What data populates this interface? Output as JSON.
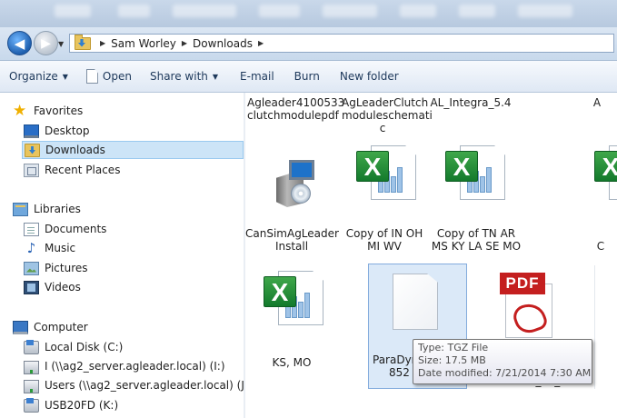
{
  "breadcrumb": {
    "items": [
      "Sam Worley",
      "Downloads"
    ]
  },
  "toolbar": {
    "organize": "Organize",
    "open": "Open",
    "share_with": "Share with",
    "email": "E-mail",
    "burn": "Burn",
    "new_folder": "New folder"
  },
  "nav": {
    "favorites": "Favorites",
    "desktop": "Desktop",
    "downloads": "Downloads",
    "recent_places": "Recent Places",
    "libraries": "Libraries",
    "documents": "Documents",
    "music": "Music",
    "pictures": "Pictures",
    "videos": "Videos",
    "computer": "Computer",
    "local_disk": "Local Disk (C:)",
    "drive_i": "I (\\\\ag2_server.agleader.local) (I:)",
    "drive_j": "Users (\\\\ag2_server.agleader.local) (J:",
    "drive_k": "USB20FD (K:)"
  },
  "files": {
    "row1": [
      {
        "line1": "Agleader4100533",
        "line2": "clutchmodulepdf",
        "line3": ""
      },
      {
        "line1": "AgLeaderClutch",
        "line2": "moduleschemati",
        "line3": "c"
      },
      {
        "line1": "AL_Integra_5.4",
        "line2": "",
        "line3": ""
      },
      {
        "line1": "A",
        "line2": "",
        "line3": ""
      }
    ],
    "row2": [
      {
        "line1": "CanSimAgLeader",
        "line2": "Install",
        "icon": "installer-icon"
      },
      {
        "line1": "Copy of IN OH",
        "line2": "MI WV",
        "icon": "excel-icon"
      },
      {
        "line1": "Copy of TN AR",
        "line2": "MS KY LA SE MO",
        "icon": "excel-icon"
      },
      {
        "line1": "C",
        "line2": "",
        "icon": "excel-icon"
      }
    ],
    "row3": [
      {
        "line1": "KS, MO",
        "line2": "",
        "icon": "excel-icon"
      },
      {
        "line1": "ParaDyn",
        "line2": "852",
        "icon": "blank-file-icon"
      },
      {
        "line1": "",
        "line2": "Control_v1_5",
        "icon": "pdf-icon"
      }
    ]
  },
  "pdf_label": "PDF",
  "excel_letter": "X",
  "tooltip": {
    "type": "Type: TGZ File",
    "size": "Size: 17.5 MB",
    "modified": "Date modified: 7/21/2014 7:30 AM"
  },
  "colors": {
    "selection": "#cce4f7",
    "tile_hover": "#dbe9f8",
    "excel_green": "#1f8b3a",
    "pdf_red": "#c41f1f"
  }
}
